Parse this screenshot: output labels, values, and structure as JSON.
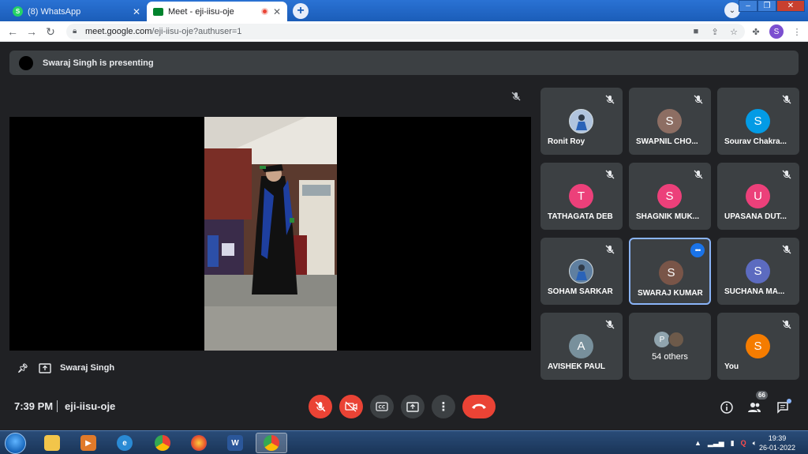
{
  "browser": {
    "tabs": [
      {
        "title": "(8) WhatsApp",
        "favicon": "whatsapp-icon",
        "favicon_color": "#25d366"
      },
      {
        "title": "Meet - eji-iisu-oje",
        "favicon": "meet-icon",
        "favicon_color": "#00832d",
        "recording_indicator_color": "#ea4335"
      }
    ],
    "url_host": "meet.google.com",
    "url_path": "/eji-iisu-oje?authuser=1",
    "profile_initial": "S"
  },
  "meet": {
    "presenting_banner": "Swaraj Singh is presenting",
    "presenter_label": "Swaraj Singh",
    "time": "7:39 PM",
    "meeting_code": "eji-iisu-oje",
    "participant_count": "66",
    "accent_color": "#8ab4f8",
    "end_call_color": "#ea4335",
    "participants": [
      {
        "name": "Ronit Roy",
        "initial": "",
        "color": "#b0c4de",
        "photo": true
      },
      {
        "name": "SWAPNIL CHO...",
        "initial": "S",
        "color": "#8d6e63"
      },
      {
        "name": "Sourav Chakra...",
        "initial": "S",
        "color": "#039be5"
      },
      {
        "name": "TATHAGATA DEB",
        "initial": "T",
        "color": "#ec407a"
      },
      {
        "name": "SHAGNIK MUK...",
        "initial": "S",
        "color": "#ec407a"
      },
      {
        "name": "UPASANA DUT...",
        "initial": "U",
        "color": "#ec407a"
      },
      {
        "name": "SOHAM SARKAR",
        "initial": "",
        "color": "#5f7fa0",
        "photo": true
      },
      {
        "name": "SWARAJ KUMAR",
        "initial": "S",
        "color": "#795548",
        "active": true
      },
      {
        "name": "SUCHANA MA...",
        "initial": "S",
        "color": "#5c6bc0"
      },
      {
        "name": "AVISHEK PAUL",
        "initial": "A",
        "color": "#78909c"
      },
      {
        "name": "54 others",
        "initial": "P",
        "color": "#90a4ae",
        "others": true
      },
      {
        "name": "You",
        "initial": "S",
        "color": "#f57c00"
      }
    ]
  },
  "taskbar": {
    "word_label": "W",
    "clock_time": "19:39",
    "clock_date": "26-01-2022"
  }
}
